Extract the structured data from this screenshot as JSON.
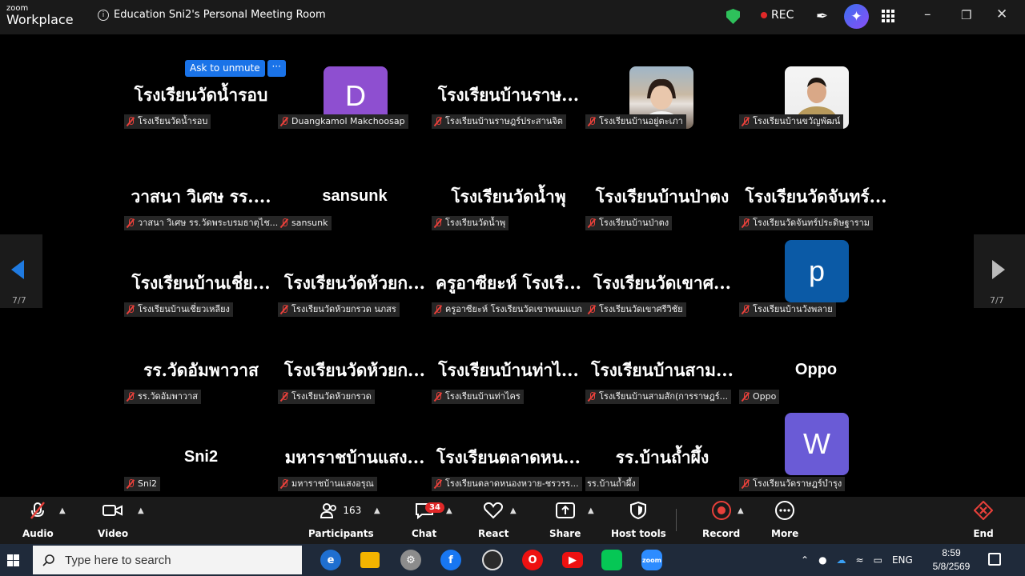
{
  "window": {
    "brand_small": "zoom",
    "brand_big": "Workplace",
    "meeting_title": "Education Sni2's Personal Meeting Room",
    "rec_label": "REC"
  },
  "gallery": {
    "page_indicator": "7/7",
    "ask_unmute": "Ask to unmute",
    "more_dots": "···",
    "tiles": [
      {
        "name": "โรงเรียนวัดน้ำรอบ",
        "label": "โรงเรียนวัดน้ำรอบ"
      },
      {
        "name": "D",
        "label": "Duangkamol Makchoosap",
        "avatar_color": "#8e4fd0"
      },
      {
        "name": "โรงเรียนบ้านราษ...",
        "label": "โรงเรียนบ้านราษฎร์ประสานจิต"
      },
      {
        "name": "",
        "label": "โรงเรียนบ้านอยู่ตะเภา"
      },
      {
        "name": "",
        "label": "โรงเรียนบ้านขวัญพัฒน์"
      },
      {
        "name": "วาสนา วิเศษ รร....",
        "label": "วาสนา วิเศษ รร.วัดพระบรมธาตุไช..."
      },
      {
        "name": "sansunk",
        "label": "sansunk"
      },
      {
        "name": "โรงเรียนวัดน้ำพุ",
        "label": "โรงเรียนวัดน้ำพุ"
      },
      {
        "name": "โรงเรียนบ้านป่าตง",
        "label": "โรงเรียนบ้านป่าตง"
      },
      {
        "name": "โรงเรียนวัดจันทร์...",
        "label": "โรงเรียนวัดจันทร์ประดิษฐาราม"
      },
      {
        "name": "โรงเรียนบ้านเชี่ย...",
        "label": "โรงเรียนบ้านเชี่ยวเหลียง"
      },
      {
        "name": "โรงเรียนวัดห้วยก...",
        "label": "โรงเรียนวัดห้วยกรวด นภสร"
      },
      {
        "name": "ครูอาซียะห์ โรงเรี...",
        "label": "ครูอาซียะห์ โรงเรียนวัดเขาพนมแบก"
      },
      {
        "name": "โรงเรียนวัดเขาศ...",
        "label": "โรงเรียนวัดเขาศรีวิชัย"
      },
      {
        "name": "p",
        "label": "โรงเรียนบ้านวังพลาย",
        "avatar_color": "#0b5aa6"
      },
      {
        "name": "รร.วัดอัมพาวาส",
        "label": "รร.วัดอัมพาวาส"
      },
      {
        "name": "โรงเรียนวัดห้วยก...",
        "label": "โรงเรียนวัดห้วยกรวด"
      },
      {
        "name": "โรงเรียนบ้านท่าไ...",
        "label": "โรงเรียนบ้านท่าไคร"
      },
      {
        "name": "โรงเรียนบ้านสาม...",
        "label": "โรงเรียนบ้านสามสัก(การราษฎร์..."
      },
      {
        "name": "Oppo",
        "label": "Oppo"
      },
      {
        "name": "Sni2",
        "label": "Sni2"
      },
      {
        "name": "มหาราชบ้านแสง...",
        "label": "มหาราชบ้านแสงอรุณ"
      },
      {
        "name": "โรงเรียนตลาดหน...",
        "label": "โรงเรียนตลาดหนองหวาย-ชรวรร..."
      },
      {
        "name": "รร.บ้านถ้ำผึ้ง",
        "label": "รร.บ้านถ้ำผึ้ง"
      },
      {
        "name": "W",
        "label": "โรงเรียนวัดราษฎร์บำรุง",
        "avatar_color": "#6a5bd6"
      }
    ]
  },
  "toolbar": {
    "audio": "Audio",
    "video": "Video",
    "participants": "Participants",
    "participants_count": "163",
    "chat": "Chat",
    "chat_badge": "34",
    "react": "React",
    "share": "Share",
    "host_tools": "Host tools",
    "record": "Record",
    "more": "More",
    "end": "End"
  },
  "taskbar": {
    "search_placeholder": "Type here to search",
    "lang": "ENG",
    "time": "8:59",
    "date": "5/8/2569"
  }
}
